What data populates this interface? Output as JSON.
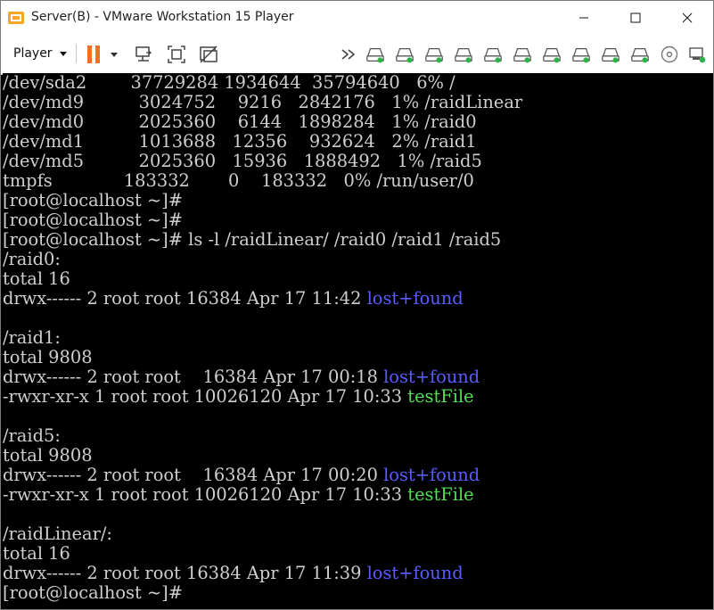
{
  "window": {
    "title": "Server(B) - VMware Workstation 15 Player"
  },
  "toolbar": {
    "player_label": "Player"
  },
  "terminal": {
    "lines": [
      [
        {
          "t": "/dev/sda2        37729284 1934644  35794640   6% /"
        }
      ],
      [
        {
          "t": "/dev/md9          3024752    9216   2842176   1% /raidLinear"
        }
      ],
      [
        {
          "t": "/dev/md0          2025360    6144   1898284   1% /raid0"
        }
      ],
      [
        {
          "t": "/dev/md1          1013688   12356    932624   2% /raid1"
        }
      ],
      [
        {
          "t": "/dev/md5          2025360   15936   1888492   1% /raid5"
        }
      ],
      [
        {
          "t": "tmpfs             183332       0    183332   0% /run/user/0"
        }
      ],
      [
        {
          "t": "[root@localhost ~]#"
        }
      ],
      [
        {
          "t": "[root@localhost ~]#"
        }
      ],
      [
        {
          "t": "[root@localhost ~]# ls -l /raidLinear/ /raid0 /raid1 /raid5"
        }
      ],
      [
        {
          "t": "/raid0:"
        }
      ],
      [
        {
          "t": "total 16"
        }
      ],
      [
        {
          "t": "drwx------ 2 root root 16384 Apr 17 11:42 "
        },
        {
          "t": "lost+found",
          "c": "blue"
        }
      ],
      [
        {
          "t": ""
        }
      ],
      [
        {
          "t": "/raid1:"
        }
      ],
      [
        {
          "t": "total 9808"
        }
      ],
      [
        {
          "t": "drwx------ 2 root root    16384 Apr 17 00:18 "
        },
        {
          "t": "lost+found",
          "c": "blue"
        }
      ],
      [
        {
          "t": "-rwxr-xr-x 1 root root 10026120 Apr 17 10:33 "
        },
        {
          "t": "testFile",
          "c": "green"
        }
      ],
      [
        {
          "t": ""
        }
      ],
      [
        {
          "t": "/raid5:"
        }
      ],
      [
        {
          "t": "total 9808"
        }
      ],
      [
        {
          "t": "drwx------ 2 root root    16384 Apr 17 00:20 "
        },
        {
          "t": "lost+found",
          "c": "blue"
        }
      ],
      [
        {
          "t": "-rwxr-xr-x 1 root root 10026120 Apr 17 10:33 "
        },
        {
          "t": "testFile",
          "c": "green"
        }
      ],
      [
        {
          "t": ""
        }
      ],
      [
        {
          "t": "/raidLinear/:"
        }
      ],
      [
        {
          "t": "total 16"
        }
      ],
      [
        {
          "t": "drwx------ 2 root root 16384 Apr 17 11:39 "
        },
        {
          "t": "lost+found",
          "c": "blue"
        }
      ],
      [
        {
          "t": "[root@localhost ~]#"
        }
      ]
    ]
  },
  "icons": {
    "app": "vmware-icon",
    "pause": "pause-icon",
    "send_keys": "send-ctrl-alt-del-icon",
    "fit": "fit-guest-icon",
    "unity": "unity-icon",
    "more": "double-chevron-icon",
    "device": "hard-disk-icon"
  },
  "colors": {
    "terminal_bg": "#000000",
    "terminal_fg": "#cfcfcf",
    "dir_color": "#5b5bff",
    "exec_color": "#52e052",
    "pause_orange": "#f36f21",
    "device_active": "#2db34a"
  }
}
